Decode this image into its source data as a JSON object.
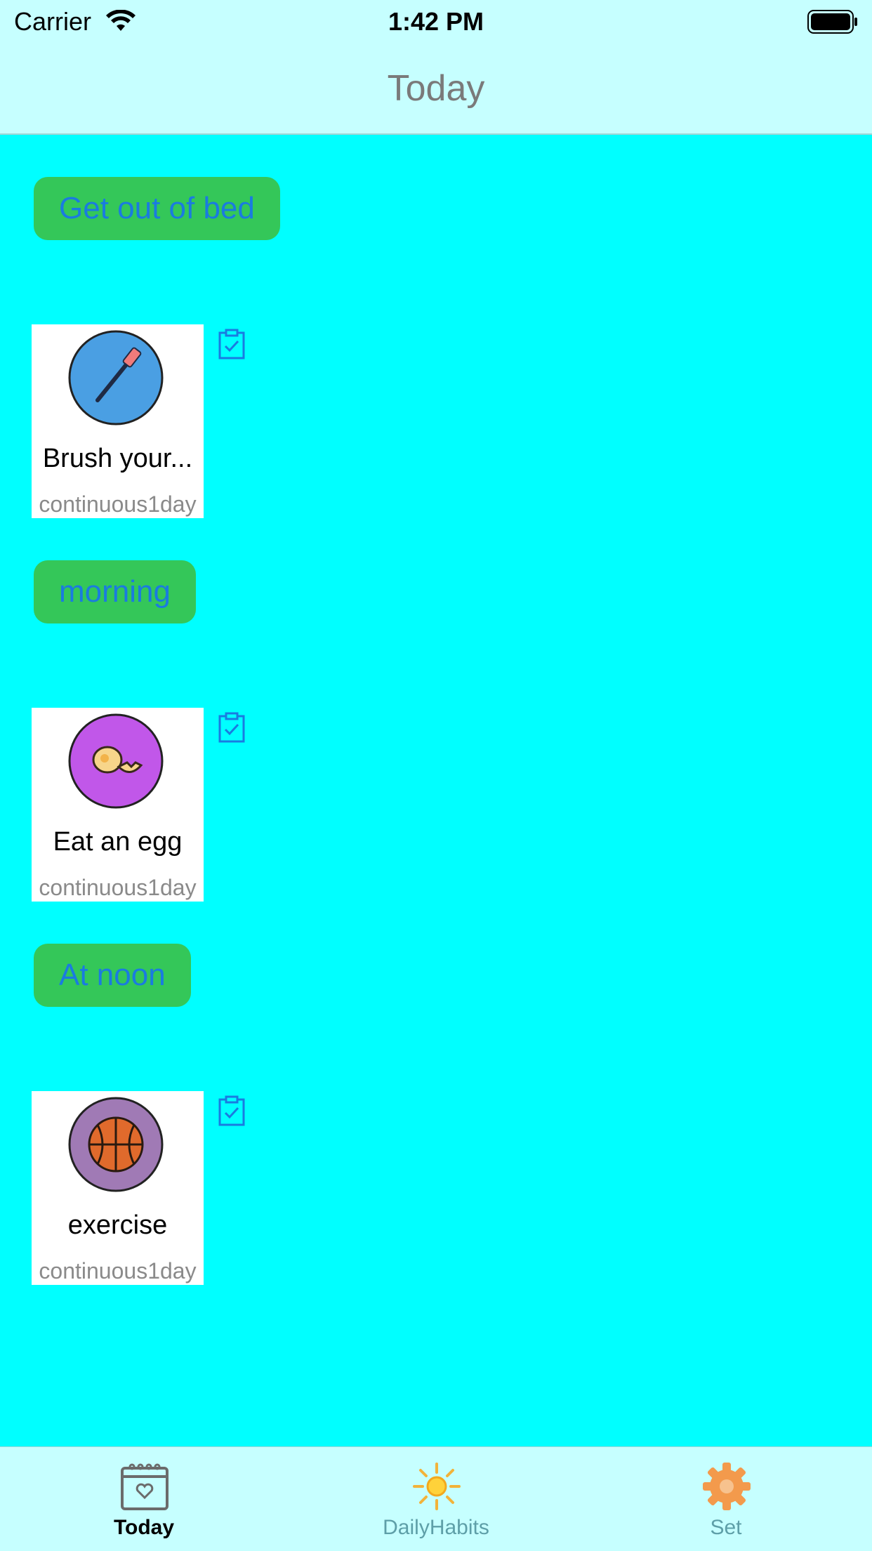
{
  "status_bar": {
    "carrier": "Carrier",
    "time": "1:42 PM"
  },
  "nav": {
    "title": "Today"
  },
  "sections": [
    {
      "label": "Get out of bed",
      "habit": {
        "name": "Brush your...",
        "streak": "continuous1day",
        "icon": "toothbrush-icon"
      }
    },
    {
      "label": "morning",
      "habit": {
        "name": "Eat an egg",
        "streak": "continuous1day",
        "icon": "egg-icon"
      }
    },
    {
      "label": "At noon",
      "habit": {
        "name": "exercise",
        "streak": "continuous1day",
        "icon": "basketball-icon"
      }
    }
  ],
  "tabs": [
    {
      "label": "Today",
      "icon": "calendar-heart-icon",
      "active": true
    },
    {
      "label": "DailyHabits",
      "icon": "sun-icon",
      "active": false
    },
    {
      "label": "Set",
      "icon": "gear-icon",
      "active": false
    }
  ],
  "colors": {
    "background": "#00FFFF",
    "bars": "#C6FFFF",
    "chip": "#34C759",
    "chip_text": "#1A7BE0",
    "check_icon": "#1A7BE0"
  }
}
